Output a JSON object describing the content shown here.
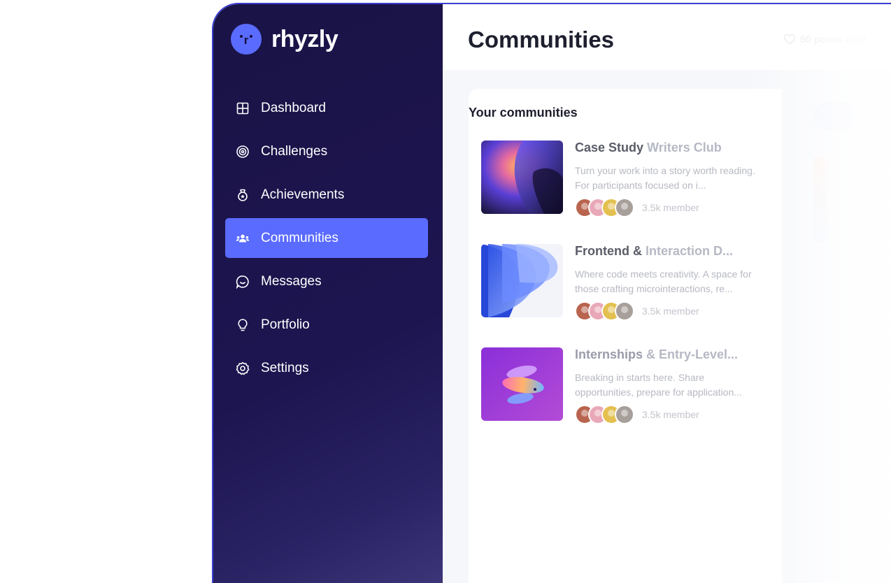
{
  "brand": {
    "name": "rhyzly",
    "mark": "r"
  },
  "sidebar": {
    "items": [
      {
        "label": "Dashboard",
        "icon": "grid-icon"
      },
      {
        "label": "Challenges",
        "icon": "target-icon"
      },
      {
        "label": "Achievements",
        "icon": "medal-icon"
      },
      {
        "label": "Communities",
        "icon": "people-icon",
        "active": true
      },
      {
        "label": "Messages",
        "icon": "chat-icon"
      },
      {
        "label": "Portfolio",
        "icon": "lightbulb-icon"
      },
      {
        "label": "Settings",
        "icon": "gear-icon"
      }
    ]
  },
  "header": {
    "title": "Communities",
    "points": "50 points until"
  },
  "your_communities": {
    "title": "Your communities",
    "items": [
      {
        "name_dark": "Case Study",
        "name_light": " Writers Club",
        "description": "Turn your work into a story worth reading. For participants focused on i...",
        "members": "3.5k member"
      },
      {
        "name_dark": "Frontend & ",
        "name_light": "Interaction D...",
        "description": "Where code meets creativity. A space for those crafting microinteractions, re...",
        "members": "3.5k member"
      },
      {
        "name_dark": "Internships ",
        "name_light": "& Entry-Level...",
        "description": "Breaking in starts here. Share opportunities, prepare for application...",
        "members": "3.5k member"
      }
    ]
  },
  "colors": {
    "sidebar_bg": "#1d1550",
    "accent": "#5a6bff",
    "title": "#1e1f2e"
  }
}
